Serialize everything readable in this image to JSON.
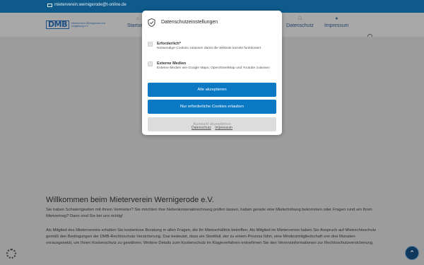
{
  "topbar": {
    "email": "mieterverein.wernigerode@t-online.de",
    "icon": "envelope-icon"
  },
  "header": {
    "logo_mark": "DMB",
    "logo_text": "Mieterverein Wernigerode und Umgebung e.V.",
    "nav": [
      {
        "label": "Startseite",
        "icon": "home-icon"
      },
      {
        "label": "Datenschutz",
        "icon": "document-icon"
      },
      {
        "label": "Impressum",
        "icon": "info-icon"
      }
    ],
    "search_icon": "search-icon"
  },
  "main": {
    "title": "Willkommen beim Mieterverein Wernigerode e.V.",
    "paragraph1": "Sie haben Schwierigkeiten mit Ihrem Vermieter? Sie möchten Ihre Nebenkostenabrechnung prüfen lassen, haben gerade eine Mieterhöhung bekommen oder Fragen rund um Ihren Mietvertrag? Dann sind Sie bei uns richtig!",
    "paragraph2": "Als Mitglied des Mietervereins erhalten Sie kostenlose Beratung in allen Fragen, die Ihr Mietverhältnis betreffen. Als Mitglied im Mieterverein haben Sie Anspruch auf Mietrechtsschutz gemäß den Bedingungen der DMB-Rechtsschutz-Versicherung. Das bedeutet, dass ein Streitfall, der zu einem Prozess führt, eine Mindestmitgliedschaft von drei Monaten vorausgesetzt, um Ihnen Kostenschutz zu gewähren. Weitere Details zum Kostenschutz im Klageverfahren entnehmen Sie den Vereinsinformationen zur Rechtsschutzversicherung."
  },
  "cookie_modal": {
    "title": "Datenschutzeinstellungen",
    "options": [
      {
        "label": "Erforderlich*",
        "description": "Notwendige Cookies zulassen damit die Website korrekt funktioniert"
      },
      {
        "label": "Externe Medien",
        "description": "Externe Medien wie Google Maps, OpenStreetMap und Youtube zulassen"
      }
    ],
    "accept_all": "Alle akzeptieren",
    "accept_required": "Nur erforderliche Cookies erlauben",
    "accept_selection": "Auswahl akzeptieren",
    "link_privacy": "Datenschutz",
    "link_imprint": "Impressum"
  },
  "colors": {
    "primary": "#0b78c4",
    "topbar": "#0e5a8a",
    "overlay": "#9c9c9c"
  }
}
